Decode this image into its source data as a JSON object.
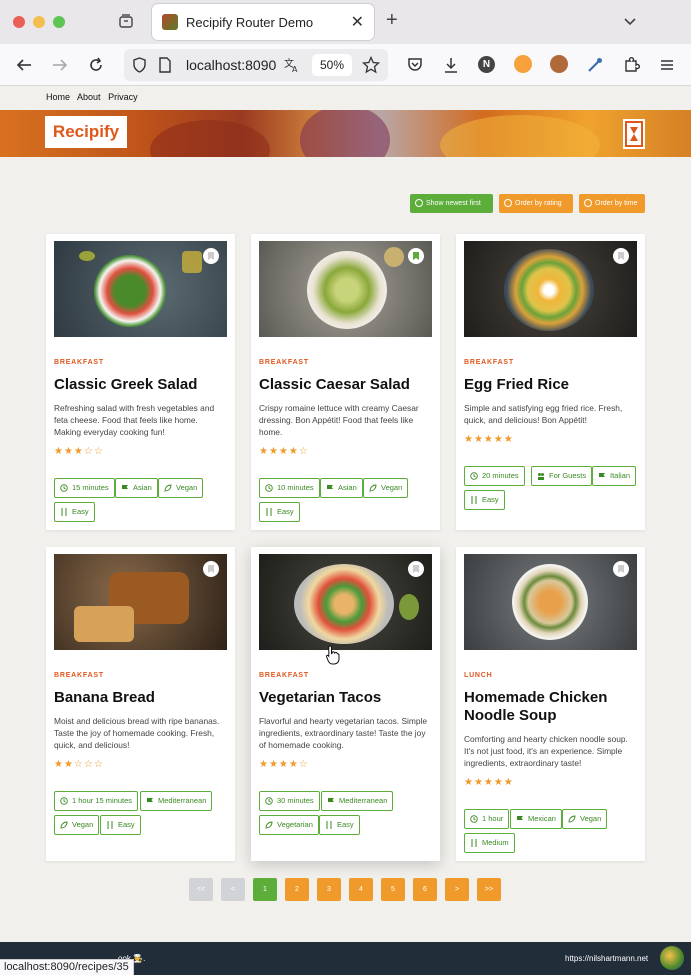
{
  "browser": {
    "tab_title": "Recipify Router Demo",
    "url": "localhost:8090",
    "zoom": "50%",
    "status_url": "localhost:8090/recipes/35",
    "extension_n": "N"
  },
  "nav": {
    "items": [
      "Home",
      "About",
      "Privacy"
    ]
  },
  "brand": {
    "logo": "Recipify"
  },
  "sort": {
    "newest": "Show newest first",
    "rating": "Order by rating",
    "time": "Order by time"
  },
  "recipes": [
    {
      "category": "BREAKFAST",
      "title": "Classic Greek Salad",
      "description": "Refreshing salad with fresh vegetables and feta cheese. Food that feels like home. Making everyday cooking fun!",
      "rating": 3,
      "bookmarked": false,
      "tags": [
        "15 minutes",
        "Asian",
        "Vegan",
        "Easy"
      ]
    },
    {
      "category": "BREAKFAST",
      "title": "Classic Caesar Salad",
      "description": "Crispy romaine lettuce with creamy Caesar dressing. Bon Appétit! Food that feels like home.",
      "rating": 4,
      "bookmarked": true,
      "tags": [
        "10 minutes",
        "Asian",
        "Vegan",
        "Easy"
      ]
    },
    {
      "category": "BREAKFAST",
      "title": "Egg Fried Rice",
      "description": "Simple and satisfying egg fried rice. Fresh, quick, and delicious! Bon Appétit!",
      "rating": 5,
      "bookmarked": false,
      "tags": [
        "20 minutes",
        "For Guests",
        "Italian",
        "Easy"
      ]
    },
    {
      "category": "BREAKFAST",
      "title": "Banana Bread",
      "description": "Moist and delicious bread with ripe bananas. Taste the joy of homemade cooking. Fresh, quick, and delicious!",
      "rating": 2,
      "bookmarked": false,
      "tags": [
        "1 hour 15 minutes",
        "Mediterranean",
        "Vegan",
        "Easy"
      ]
    },
    {
      "category": "BREAKFAST",
      "title": "Vegetarian Tacos",
      "description": "Flavorful and hearty vegetarian tacos. Simple ingredients, extraordinary taste! Taste the joy of homemade cooking.",
      "rating": 4,
      "bookmarked": false,
      "tags": [
        "30 minutes",
        "Mediterranean",
        "Vegetarian",
        "Easy"
      ]
    },
    {
      "category": "LUNCH",
      "title": "Homemade Chicken Noodle Soup",
      "description": "Comforting and hearty chicken noodle soup. It's not just food, it's an experience. Simple ingredients, extraordinary taste!",
      "rating": 5,
      "bookmarked": false,
      "tags": [
        "1 hour",
        "Mexican",
        "Vegan",
        "Medium"
      ]
    }
  ],
  "pagination": [
    "<<",
    "<",
    "1",
    "2",
    "3",
    "4",
    "5",
    "6",
    ">",
    ">>"
  ],
  "footer": {
    "left": "ook 🧑‍🍳.",
    "right": "https://nilshartmann.net"
  },
  "colors": {
    "accent": "#e0571c",
    "green": "#5cad3a",
    "orange": "#f19a2c",
    "footer": "#222d3a"
  }
}
